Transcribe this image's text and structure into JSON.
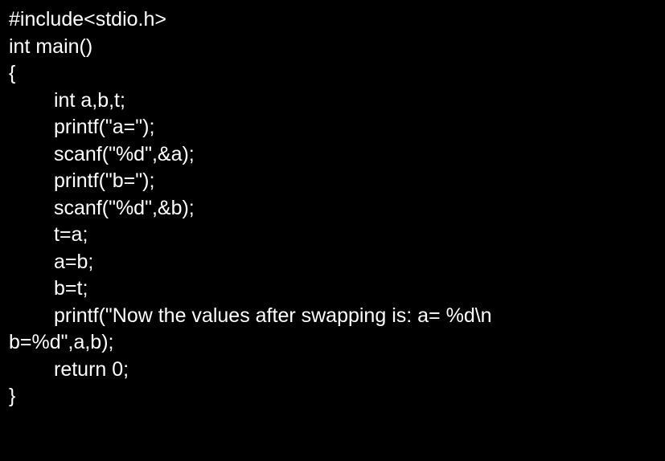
{
  "colors": {
    "background": "#000000",
    "text": "#ffffff"
  },
  "code": {
    "lines": [
      "#include<stdio.h>",
      "int main()",
      "{",
      "int a,b,t;",
      "printf(\"a=\");",
      "scanf(\"%d\",&a);",
      "printf(\"b=\");",
      "scanf(\"%d\",&b);",
      "t=a;",
      "a=b;",
      "b=t;",
      "printf(\"Now the values after swapping is: a= %d\\n",
      "b=%d\",a,b);",
      "return 0;",
      "}"
    ]
  }
}
